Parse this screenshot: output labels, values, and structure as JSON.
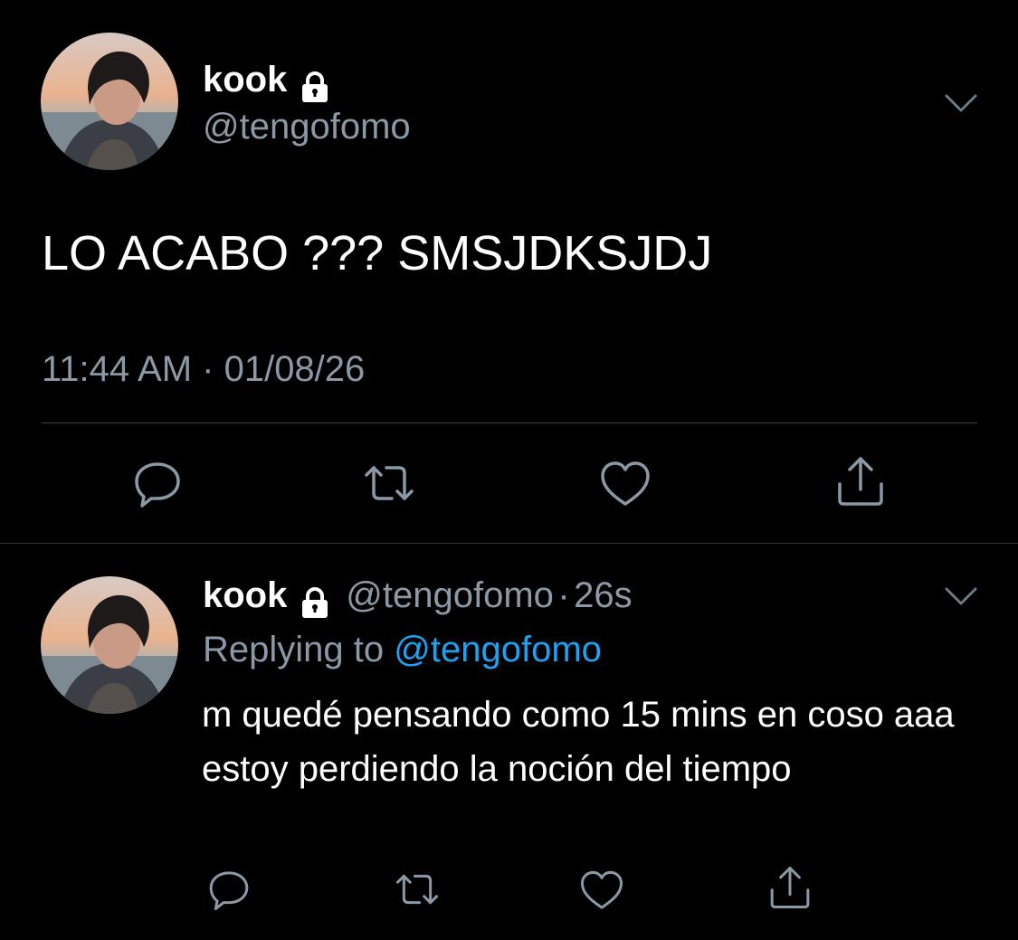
{
  "colors": {
    "background": "#000000",
    "primary_text": "#ffffff",
    "secondary_text": "#8b98a5",
    "link": "#1da1f2",
    "divider": "#38444d"
  },
  "main_tweet": {
    "display_name": "kook",
    "handle": "@tengofomo",
    "text": "LO ACABO ??? SMSJDKSJDJ",
    "timestamp": "11:44 AM · 01/08/26",
    "icons": [
      "lock-icon",
      "chevron-down-icon",
      "reply-icon",
      "retweet-icon",
      "like-icon",
      "share-icon"
    ]
  },
  "reply_tweet": {
    "display_name": "kook",
    "handle": "@tengofomo",
    "separator": "·",
    "age": "26s",
    "replying_prefix": "Replying to",
    "replying_to": "@tengofomo",
    "text": "m quedé pensando como 15 mins en coso aaa estoy perdiendo la noción del tiempo",
    "icons": [
      "lock-icon",
      "chevron-down-icon",
      "reply-icon",
      "retweet-icon",
      "like-icon",
      "share-icon"
    ]
  }
}
